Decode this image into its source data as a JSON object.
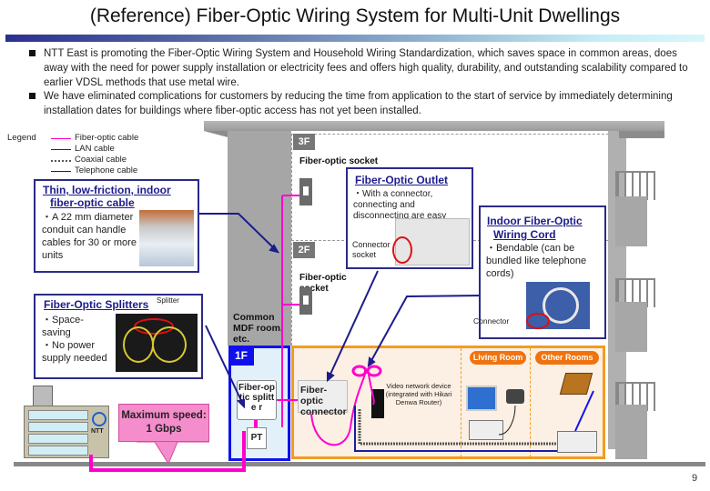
{
  "title": "(Reference) Fiber-Optic Wiring System for Multi-Unit Dwellings",
  "bullets": [
    "NTT East is promoting the Fiber-Optic Wiring System and Household Wiring Standardization, which saves space in common areas, does away with the need for power supply installation or electricity fees and offers high quality, durability, and outstanding scalability compared to earlier VDSL methods that use metal wire.",
    "We have eliminated complications for customers by reducing the time from application to the start of service by immediately determining installation dates for buildings where fiber-optic access has not yet been installed."
  ],
  "legend": {
    "label": "Legend",
    "items": [
      {
        "name": "Fiber-optic cable",
        "color": "#ff00cc",
        "style": "solid"
      },
      {
        "name": "LAN cable",
        "color": "#1a1aa8",
        "style": "solid"
      },
      {
        "name": "Coaxial cable",
        "color": "#555555",
        "style": "dotted"
      },
      {
        "name": "Telephone cable",
        "color": "#222222",
        "style": "solid"
      }
    ]
  },
  "floors": {
    "f3": "3F",
    "f2": "2F",
    "f1": "1F"
  },
  "labels": {
    "socket_3f": "Fiber-optic socket",
    "socket_2f_1": "Fiber-optic",
    "socket_2f_2": "socket",
    "mdf_1": "Common",
    "mdf_2": "MDF room,",
    "mdf_3": "etc.",
    "splitter_unit": "Fiber-optic splitte r",
    "pt": "PT",
    "connector": "Fiber-optic connector",
    "video_device": "Video network device (integrated with Hikari Denwa Router)",
    "living_room": "Living Room",
    "other_rooms": "Other Rooms",
    "speed": "Maximum speed:  1 Gbps",
    "ntt": "NTT"
  },
  "boxes": {
    "cable": {
      "title_1": "Thin, low-friction, indoor",
      "title_2": "fiber-optic cable",
      "text": "・A 22 mm diameter conduit can handle cables for 30 or more units"
    },
    "splitters": {
      "title": "Fiber-Optic Splitters",
      "photo_label": "Splitter",
      "text_1": "・Space-saving",
      "text_2": "・No power supply needed"
    },
    "outlet": {
      "title": "Fiber-Optic Outlet",
      "text": "・With a connector, connecting and disconnecting are easy",
      "photo_label_1": "Connector",
      "photo_label_2": "socket"
    },
    "cord": {
      "title_1": "Indoor Fiber-Optic",
      "title_2": "Wiring Cord",
      "text": "・Bendable  (can be bundled like telephone cords)",
      "photo_label": "Connector"
    }
  },
  "page_number": "9",
  "colors": {
    "fiber": "#ff00cc",
    "lan": "#1a1aa8",
    "floor1_border": "#1010ee",
    "home_border": "#f39b1f",
    "room_pill": "#f0730f",
    "speed_bubble": "#f58ccc"
  }
}
